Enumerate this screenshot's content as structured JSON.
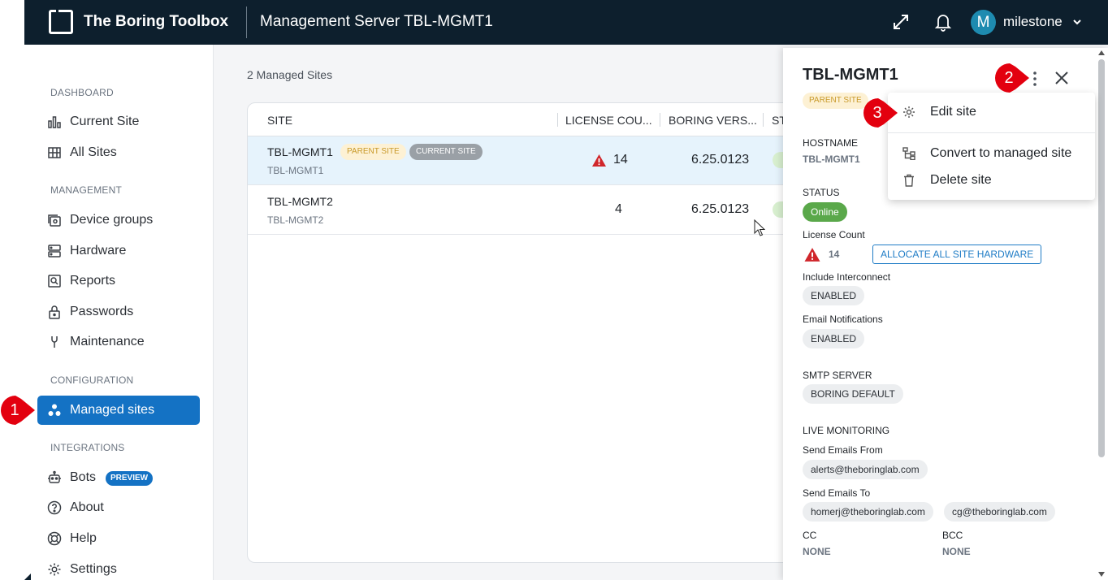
{
  "topbar": {
    "app_name": "The Boring Toolbox",
    "server_title": "Management Server TBL-MGMT1",
    "avatar_letter": "M",
    "user_name": "milestone"
  },
  "sidebar": {
    "sections": {
      "dashboard": "DASHBOARD",
      "management": "MANAGEMENT",
      "configuration": "CONFIGURATION",
      "integrations": "INTEGRATIONS"
    },
    "items": [
      {
        "label": "Current Site",
        "icon": "bar-chart-icon"
      },
      {
        "label": "All Sites",
        "icon": "grid-icon"
      },
      {
        "label": "Device groups",
        "icon": "device-groups-icon"
      },
      {
        "label": "Hardware",
        "icon": "server-icon"
      },
      {
        "label": "Reports",
        "icon": "report-icon"
      },
      {
        "label": "Passwords",
        "icon": "lock-icon"
      },
      {
        "label": "Maintenance",
        "icon": "wrench-icon"
      },
      {
        "label": "Managed sites",
        "icon": "sites-icon",
        "active": true
      },
      {
        "label": "Bots",
        "icon": "bot-icon",
        "badge": "PREVIEW"
      },
      {
        "label": "About",
        "icon": "help-circle-icon"
      },
      {
        "label": "Help",
        "icon": "lifebuoy-icon"
      },
      {
        "label": "Settings",
        "icon": "gear-icon"
      }
    ]
  },
  "main": {
    "site_count": "2 Managed Sites",
    "columns": [
      "SITE",
      "LICENSE COU...",
      "BORING VERS...",
      "ST"
    ],
    "rows": [
      {
        "name": "TBL-MGMT1",
        "host": "TBL-MGMT1",
        "tag_parent": "PARENT SITE",
        "tag_current": "CURRENT SITE",
        "license": "14",
        "version": "6.25.0123"
      },
      {
        "name": "TBL-MGMT2",
        "host": "TBL-MGMT2",
        "license": "4",
        "version": "6.25.0123"
      }
    ]
  },
  "panel": {
    "title": "TBL-MGMT1",
    "tag_parent": "PARENT SITE",
    "hostname_label": "HOSTNAME",
    "hostname_value": "TBL-MGMT1",
    "status_label": "STATUS",
    "status_value": "Online",
    "license_label": "License Count",
    "license_value": "14",
    "allocate_label": "ALLOCATE ALL SITE HARDWARE",
    "interconnect_label": "Include Interconnect",
    "interconnect_value": "ENABLED",
    "email_notif_label": "Email Notifications",
    "email_notif_value": "ENABLED",
    "smtp_label": "SMTP SERVER",
    "smtp_value": "BORING DEFAULT",
    "live_label": "LIVE MONITORING",
    "from_label": "Send Emails From",
    "from_value": "alerts@theboringlab.com",
    "to_label": "Send Emails To",
    "to_values": [
      "homerj@theboringlab.com",
      "cg@theboringlab.com"
    ],
    "cc_label": "CC",
    "cc_value": "NONE",
    "bcc_label": "BCC",
    "bcc_value": "NONE"
  },
  "menu": {
    "items": [
      {
        "label": "Edit site",
        "icon": "gear-icon"
      },
      {
        "label": "Convert to managed site",
        "icon": "hierarchy-icon"
      },
      {
        "label": "Delete site",
        "icon": "trash-icon"
      }
    ]
  },
  "markers": [
    "1",
    "2",
    "3"
  ],
  "colors": {
    "topbar": "#0d1f2d",
    "accent": "#1472c4",
    "marker": "#e3000f",
    "online": "#5aa84a",
    "warning": "#d0262b"
  }
}
